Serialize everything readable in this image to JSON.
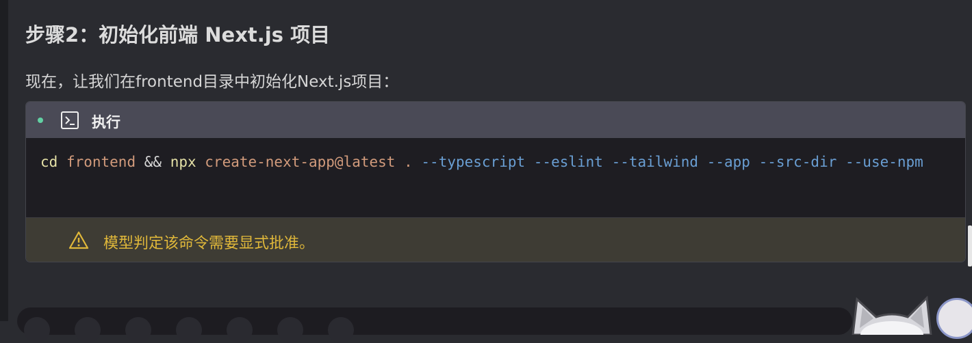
{
  "heading": "步骤2：初始化前端 Next.js 项目",
  "paragraph": "现在，让我们在frontend目录中初始化Next.js项目：",
  "tool_card": {
    "title": "执行",
    "icon": "terminal-icon",
    "status_color": "#62d0a3",
    "command": {
      "tokens": [
        {
          "text": "cd",
          "kind": "cmd"
        },
        {
          "text": " ",
          "kind": "op"
        },
        {
          "text": "frontend",
          "kind": "arg"
        },
        {
          "text": " && ",
          "kind": "op"
        },
        {
          "text": "npx",
          "kind": "cmd"
        },
        {
          "text": " ",
          "kind": "op"
        },
        {
          "text": "create-next-app@latest",
          "kind": "arg"
        },
        {
          "text": " ",
          "kind": "op"
        },
        {
          "text": ".",
          "kind": "arg"
        },
        {
          "text": " ",
          "kind": "op"
        },
        {
          "text": "--typescript",
          "kind": "flag"
        },
        {
          "text": " ",
          "kind": "op"
        },
        {
          "text": "--eslint",
          "kind": "flag"
        },
        {
          "text": " ",
          "kind": "op"
        },
        {
          "text": "--tailwind",
          "kind": "flag"
        },
        {
          "text": " ",
          "kind": "op"
        },
        {
          "text": "--app",
          "kind": "flag"
        },
        {
          "text": " ",
          "kind": "op"
        },
        {
          "text": "--src-dir",
          "kind": "flag"
        },
        {
          "text": " ",
          "kind": "op"
        },
        {
          "text": "--use-npm",
          "kind": "flag"
        }
      ]
    },
    "warning": {
      "icon": "warning-icon",
      "text": "模型判定该命令需要显式批准。",
      "color": "#e0b83a"
    }
  },
  "colors": {
    "background": "#2a2b30",
    "header_bg": "#4a4a56",
    "code_bg": "#1e1d22",
    "warning_bg": "#3e3c34"
  }
}
